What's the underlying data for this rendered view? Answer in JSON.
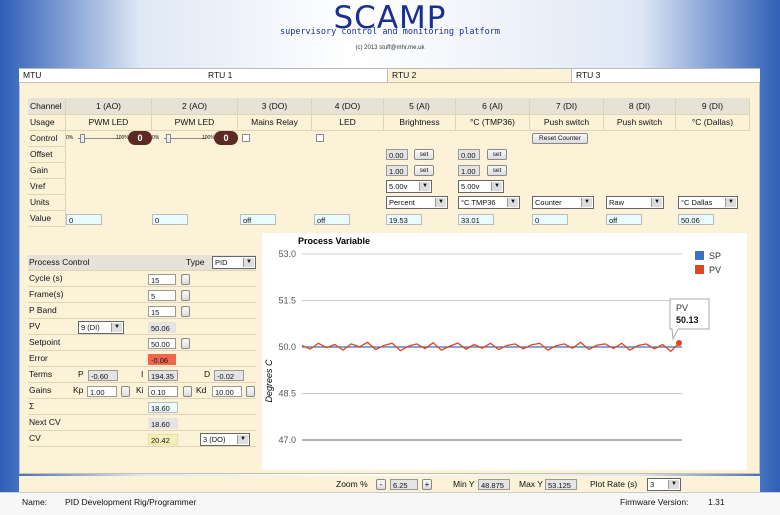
{
  "header": {
    "title": "SCAMP",
    "subtitle": "supervisory control and monitoring platform",
    "copyright": "(c) 2013 stuff@mhr.me.uk"
  },
  "tabs": [
    {
      "label": "MTU",
      "active": false
    },
    {
      "label": "RTU 1",
      "active": false
    },
    {
      "label": "RTU 2",
      "active": true
    },
    {
      "label": "RTU 3",
      "active": false
    }
  ],
  "grid": {
    "row_labels": {
      "channel": "Channel",
      "usage": "Usage",
      "control": "Control",
      "offset": "Offset",
      "gain": "Gain",
      "vref": "Vref",
      "units": "Units",
      "value": "Value"
    },
    "channels": [
      "1 (AO)",
      "2 (AO)",
      "3 (DO)",
      "4 (DO)",
      "5 (AI)",
      "6 (AI)",
      "7 (DI)",
      "8 (DI)",
      "9 (DI)"
    ],
    "usage": [
      "PWM LED",
      "PWM LED",
      "Mains Relay",
      "LED",
      "Brightness",
      "°C (TMP36)",
      "Push switch",
      "Push switch",
      "°C (Dallas)"
    ],
    "slider_min": "0%",
    "slider_max": "100%",
    "knob_value": "0",
    "reset_counter_label": "Reset Counter",
    "set_label": "set",
    "offset": [
      "0.00",
      "0.00"
    ],
    "gain": [
      "1.00",
      "1.00"
    ],
    "vref": [
      "5.00v",
      "5.00v"
    ],
    "units": [
      "Percent",
      "°C TMP36",
      "Counter",
      "Raw",
      "°C Dallas"
    ],
    "values": [
      "0",
      "0",
      "off",
      "off",
      "19.53",
      "33.01",
      "0",
      "off",
      "50.06"
    ]
  },
  "process": {
    "title": "Process Control",
    "type_label": "Type",
    "type_value": "PID",
    "cycle_label": "Cycle (s)",
    "cycle_value": "15",
    "frame_label": "Frame(s)",
    "frame_value": "5",
    "pband_label": "P Band",
    "pband_value": "15",
    "pv_label": "PV",
    "pv_channel": "9 (DI)",
    "pv_value": "50.06",
    "setpoint_label": "Setpoint",
    "setpoint_value": "50.00",
    "error_label": "Error",
    "error_value": "-0.06",
    "terms_label": "Terms",
    "p_label": "P",
    "p_value": "-0.60",
    "i_label": "I",
    "i_value": "194.35",
    "d_label": "D",
    "d_value": "-0.02",
    "gains_label": "Gains",
    "kp_label": "Kp",
    "kp_value": "1.00",
    "ki_label": "Ki",
    "ki_value": "0.10",
    "kd_label": "Kd",
    "kd_value": "10.00",
    "sigma_label": "Σ",
    "sigma_value": "18.60",
    "nextcv_label": "Next CV",
    "nextcv_value": "18.60",
    "cv_label": "CV",
    "cv_value": "20.42",
    "cv_channel": "3 (DO)"
  },
  "controls": {
    "zoom_label": "Zoom %",
    "zoom_minus": "-",
    "zoom_value": "6.25",
    "zoom_plus": "+",
    "miny_label": "Min Y",
    "miny_value": "48.875",
    "maxy_label": "Max Y",
    "maxy_value": "53.125",
    "plotrate_label": "Plot Rate (s)",
    "plotrate_value": "3"
  },
  "footer": {
    "name_label": "Name:",
    "name_value": "PID Development Rig/Programmer",
    "fw_label": "Firmware Version:",
    "fw_value": "1.31"
  },
  "chart_data": {
    "type": "line",
    "title": "Process Variable",
    "ylabel": "Degrees C",
    "ylim": [
      47.0,
      53.0
    ],
    "yticks": [
      "53.0",
      "51.5",
      "50.0",
      "48.5",
      "47.0"
    ],
    "series": [
      {
        "name": "SP",
        "color": "#3a6fc4",
        "values": [
          50.0,
          50.0
        ]
      },
      {
        "name": "PV",
        "color": "#e0451e",
        "values": [
          50.05,
          49.93,
          50.12,
          49.98,
          50.08,
          49.9,
          50.1,
          50.0,
          50.15,
          49.92,
          50.05,
          50.12,
          49.88,
          50.03,
          50.1,
          49.95,
          50.14,
          49.9,
          50.02,
          50.13,
          49.93,
          50.08,
          49.96,
          50.12,
          49.92,
          50.05,
          50.1,
          49.94,
          50.07,
          50.12,
          49.9,
          50.04,
          50.1,
          49.96,
          50.15,
          49.92,
          50.06,
          50.1,
          49.95,
          50.12,
          49.9,
          50.05,
          50.1,
          49.94,
          50.08,
          49.86,
          50.13
        ]
      }
    ],
    "tooltip": {
      "series": "PV",
      "value": "50.13"
    }
  }
}
